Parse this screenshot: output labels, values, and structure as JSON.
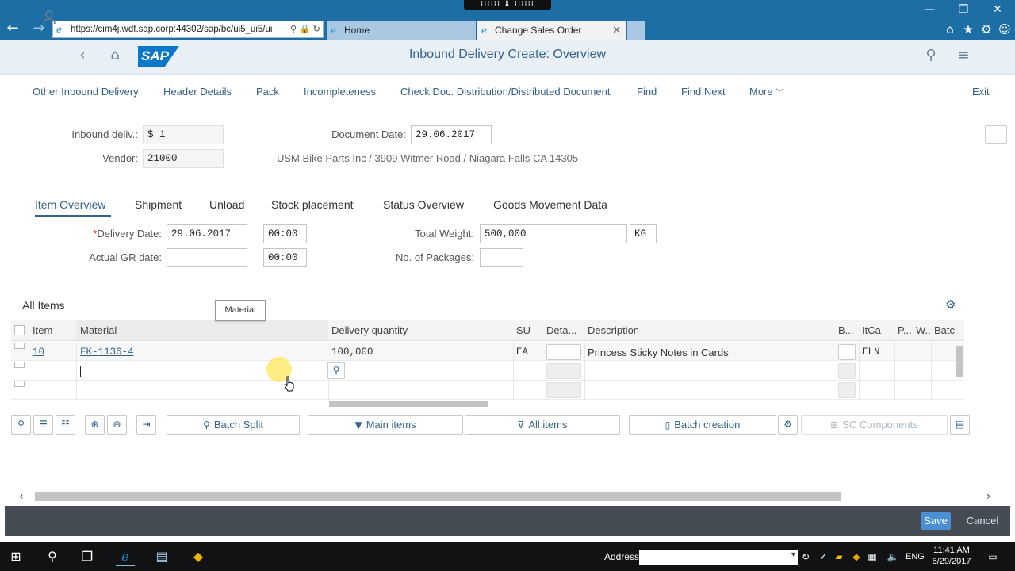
{
  "browser": {
    "url": "https://cim4j.wdf.sap.corp:44302/sap/bc/ui5_ui5/ui",
    "tabs": [
      {
        "label": "Home"
      },
      {
        "label": "Change Sales Order"
      }
    ],
    "notch_text": "⁞⁞⁞⁞⁞⁞ ⬇ ⁞⁞⁞⁞⁞⁞"
  },
  "shell": {
    "title": "Inbound Delivery  Create: Overview",
    "logo": "SAP"
  },
  "toolbar": {
    "items": [
      "Other Inbound Delivery",
      "Header Details",
      "Pack",
      "Incompleteness",
      "Check Doc. Distribution/Distributed Document",
      "Find",
      "Find Next",
      "More"
    ],
    "exit": "Exit"
  },
  "header": {
    "inbound_label": "Inbound deliv.:",
    "inbound_value": "$        1",
    "vendor_label": "Vendor:",
    "vendor_value": "21000",
    "doc_date_label": "Document Date:",
    "doc_date_value": "29.06.2017",
    "vendor_address": "USM Bike Parts Inc / 3909 Witmer Road / Niagara Falls CA 14305"
  },
  "tabs": [
    "Item Overview",
    "Shipment",
    "Unload",
    "Stock placement",
    "Status Overview",
    "Goods Movement Data"
  ],
  "delivery": {
    "delivery_date_label": "Delivery Date:",
    "delivery_date": "29.06.2017",
    "delivery_time": "00:00",
    "gr_date_label": "Actual GR date:",
    "gr_date": "",
    "gr_time": "00:00",
    "total_weight_label": "Total Weight:",
    "total_weight": "500,000",
    "weight_unit": "KG",
    "packages_label": "No. of Packages:",
    "packages": ""
  },
  "items": {
    "title": "All Items",
    "tooltip": "Material",
    "columns": [
      "Item",
      "Material",
      "Delivery quantity",
      "SU",
      "Deta...",
      "Description",
      "B...",
      "ItCa",
      "P...",
      "W...",
      "Batc"
    ],
    "rows": [
      {
        "item": "10",
        "material": "FK-1136-4",
        "qty": "100,000",
        "su": "EA",
        "description": "Princess Sticky Notes in Cards",
        "itca": "ELN"
      }
    ]
  },
  "table_buttons": {
    "batch_split": "Batch Split",
    "main_items": "Main items",
    "all_items": "All items",
    "batch_creation": "Batch creation",
    "sc_components": "SC Components"
  },
  "footer": {
    "save": "Save",
    "cancel": "Cancel"
  },
  "taskbar": {
    "address_label": "Address",
    "lang": "ENG",
    "time": "11:41 AM",
    "date": "6/29/2017"
  }
}
